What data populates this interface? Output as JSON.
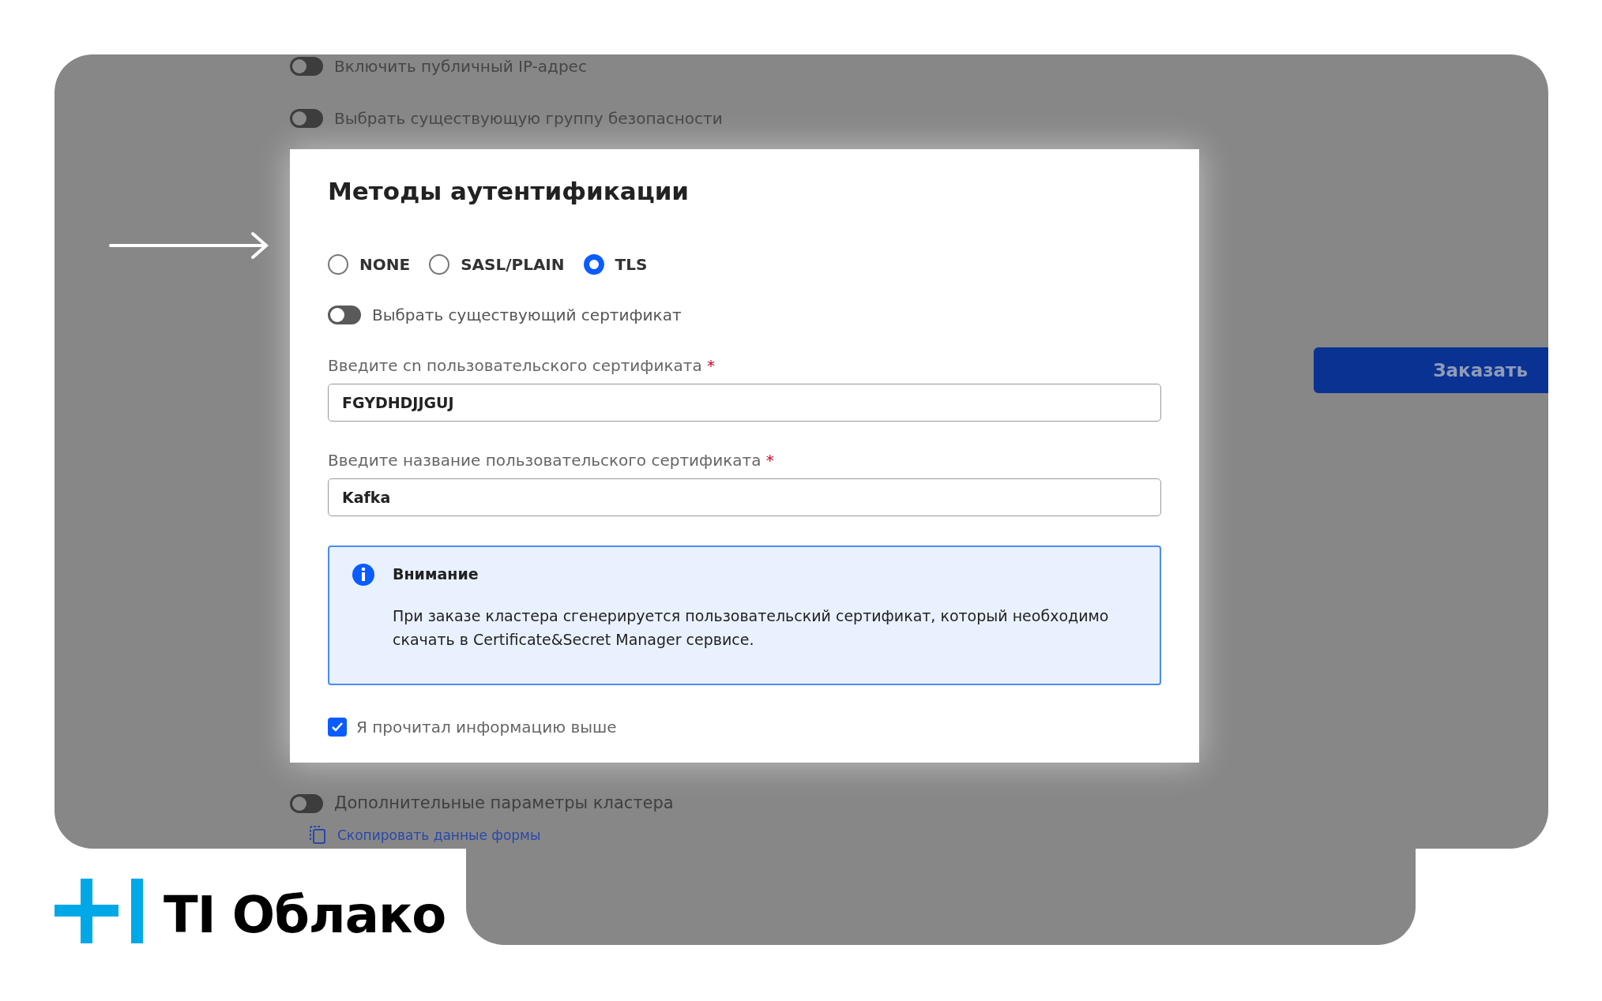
{
  "background_toggles": [
    {
      "label": "Включить публичный IP-адрес",
      "on": false
    },
    {
      "label": "Выбрать существующую группу безопасности",
      "on": false
    }
  ],
  "order_button": "Заказать",
  "modal": {
    "title": "Методы аутентификации",
    "auth_methods": [
      {
        "label": "NONE",
        "selected": false
      },
      {
        "label": "SASL/PLAIN",
        "selected": false
      },
      {
        "label": "TLS",
        "selected": true
      }
    ],
    "cert_toggle": {
      "label": "Выбрать существующий сертификат",
      "on": false
    },
    "fields": [
      {
        "label": "Введите cn пользовательского сертификата",
        "required_mark": "*",
        "value": "FGYDHDJJGUJ"
      },
      {
        "label": "Введите название пользовательского сертификата",
        "required_mark": "*",
        "value": "Kafka"
      }
    ],
    "notice": {
      "title": "Внимание",
      "text": "При заказе кластера сгенерируется пользовательский сертификат, который необходимо скачать в Certificate&Secret Manager сервисе."
    },
    "confirm": {
      "label": "Я прочитал информацию выше",
      "checked": true
    }
  },
  "footer_toggle": {
    "label": "Дополнительные параметры кластера",
    "on": false
  },
  "copy_link": "Скопировать данные формы",
  "logo": {
    "text": "TI Облако"
  }
}
